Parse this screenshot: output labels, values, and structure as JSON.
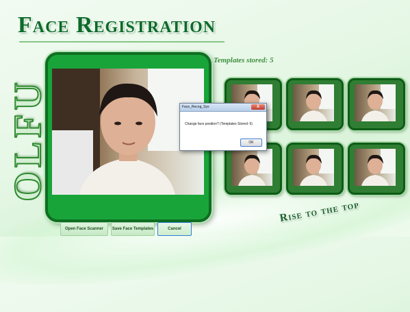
{
  "header": {
    "title": "Face Registration"
  },
  "branding": {
    "side_logo": "OLFU",
    "slogan": "Rise to the top"
  },
  "templates": {
    "label": "Templates stored: 5",
    "thumbnail_count": 6
  },
  "dialog": {
    "title": "Face_Recog_Sys",
    "message": "Change face position? (Templates Stored: 6)",
    "ok_label": "OK",
    "close_label": "X"
  },
  "buttons": {
    "open_scanner": "Open Face Scanner",
    "save_templates": "Save Face Templates",
    "cancel": "Cancel"
  },
  "colors": {
    "brand_green": "#0b6a2a",
    "frame_green": "#19a43a",
    "dialog_close_red": "#c13b2a"
  }
}
